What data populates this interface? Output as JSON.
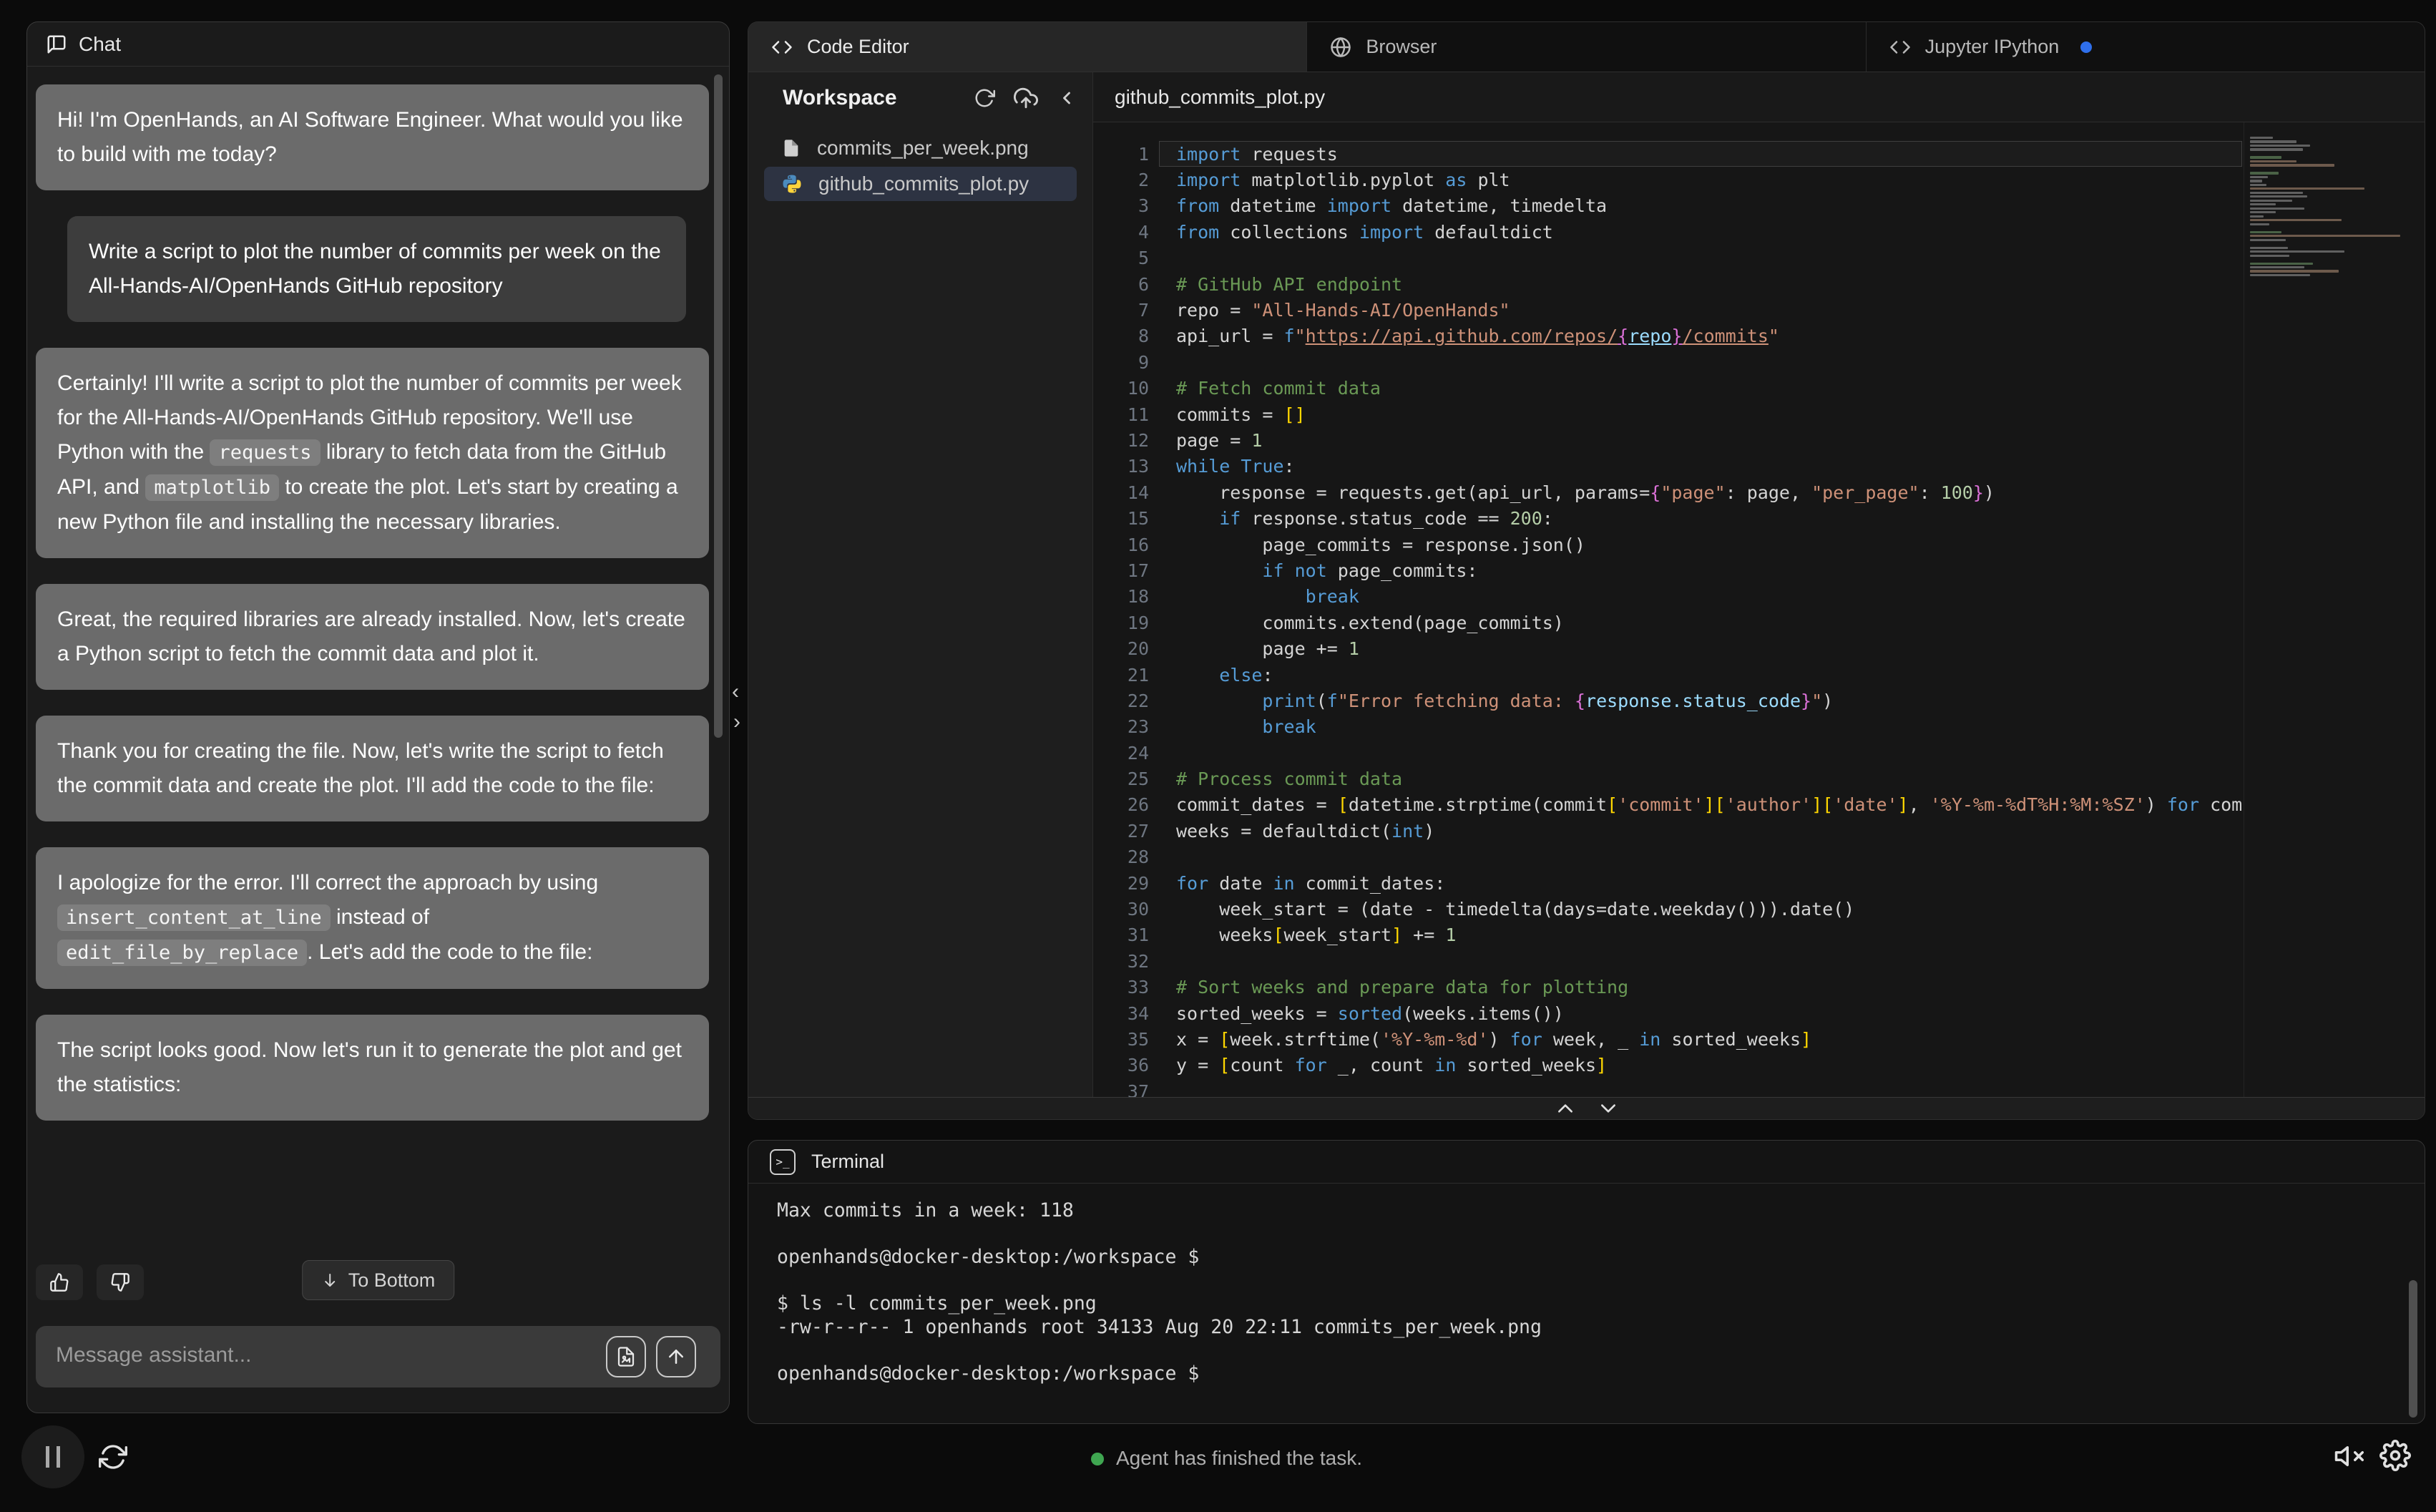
{
  "chat": {
    "title": "Chat",
    "messages": [
      {
        "role": "assistant",
        "parts": [
          {
            "t": "text",
            "v": "Hi! I'm OpenHands, an AI Software Engineer. What would you like to build with me today?"
          }
        ]
      },
      {
        "role": "user",
        "parts": [
          {
            "t": "text",
            "v": "Write a script to plot the number of commits per week on the All-Hands-AI/OpenHands GitHub repository"
          }
        ]
      },
      {
        "role": "assistant",
        "parts": [
          {
            "t": "text",
            "v": "Certainly! I'll write a script to plot the number of commits per week for the All-Hands-AI/OpenHands GitHub repository. We'll use Python with the "
          },
          {
            "t": "code",
            "v": "requests"
          },
          {
            "t": "text",
            "v": " library to fetch data from the GitHub API, and "
          },
          {
            "t": "code",
            "v": "matplotlib"
          },
          {
            "t": "text",
            "v": " to create the plot. Let's start by creating a new Python file and installing the necessary libraries."
          }
        ]
      },
      {
        "role": "assistant",
        "parts": [
          {
            "t": "text",
            "v": "Great, the required libraries are already installed. Now, let's create a Python script to fetch the commit data and plot it."
          }
        ]
      },
      {
        "role": "assistant",
        "parts": [
          {
            "t": "text",
            "v": "Thank you for creating the file. Now, let's write the script to fetch the commit data and create the plot. I'll add the code to the file:"
          }
        ]
      },
      {
        "role": "assistant",
        "parts": [
          {
            "t": "text",
            "v": "I apologize for the error. I'll correct the approach by using "
          },
          {
            "t": "code",
            "v": "insert_content_at_line"
          },
          {
            "t": "text",
            "v": " instead of "
          },
          {
            "t": "code",
            "v": "edit_file_by_replace"
          },
          {
            "t": "text",
            "v": ". Let's add the code to the file:"
          }
        ]
      },
      {
        "role": "assistant",
        "parts": [
          {
            "t": "text",
            "v": "The script looks good. Now let's run it to generate the plot and get the statistics:"
          }
        ]
      }
    ],
    "to_bottom_label": "To Bottom",
    "input_placeholder": "Message assistant..."
  },
  "tabs": [
    {
      "label": "Code Editor",
      "icon": "code",
      "active": true
    },
    {
      "label": "Browser",
      "icon": "globe",
      "active": false
    },
    {
      "label": "Jupyter IPython",
      "icon": "code",
      "active": false,
      "dot": true
    }
  ],
  "workspace": {
    "title": "Workspace",
    "files": [
      {
        "name": "commits_per_week.png",
        "icon": "file",
        "selected": false
      },
      {
        "name": "github_commits_plot.py",
        "icon": "python",
        "selected": true
      }
    ]
  },
  "editor": {
    "filename": "github_commits_plot.py",
    "lines": [
      [
        [
          "k",
          "import"
        ],
        [
          "d",
          " requests"
        ]
      ],
      [
        [
          "k",
          "import"
        ],
        [
          "d",
          " matplotlib.pyplot "
        ],
        [
          "k",
          "as"
        ],
        [
          "d",
          " plt"
        ]
      ],
      [
        [
          "k",
          "from"
        ],
        [
          "d",
          " datetime "
        ],
        [
          "k",
          "import"
        ],
        [
          "d",
          " datetime, timedelta"
        ]
      ],
      [
        [
          "k",
          "from"
        ],
        [
          "d",
          " collections "
        ],
        [
          "k",
          "import"
        ],
        [
          "d",
          " defaultdict"
        ]
      ],
      [],
      [
        [
          "c",
          "# GitHub API endpoint"
        ]
      ],
      [
        [
          "d",
          "repo = "
        ],
        [
          "s",
          "\"All-Hands-AI/OpenHands\""
        ]
      ],
      [
        [
          "d",
          "api_url = "
        ],
        [
          "k",
          "f"
        ],
        [
          "s",
          "\""
        ],
        [
          "s u",
          "https://api.github.com/repos/"
        ],
        [
          "m u",
          "{"
        ],
        [
          "v u",
          "repo"
        ],
        [
          "m u",
          "}"
        ],
        [
          "s u",
          "/commits"
        ],
        [
          "s",
          "\""
        ]
      ],
      [],
      [
        [
          "c",
          "# Fetch commit data"
        ]
      ],
      [
        [
          "d",
          "commits = "
        ],
        [
          "b",
          "[]"
        ]
      ],
      [
        [
          "d",
          "page = "
        ],
        [
          "n",
          "1"
        ]
      ],
      [
        [
          "k",
          "while"
        ],
        [
          "d",
          " "
        ],
        [
          "k",
          "True"
        ],
        [
          "d",
          ":"
        ]
      ],
      [
        [
          "d",
          "    response = requests.get(api_url, params="
        ],
        [
          "m",
          "{"
        ],
        [
          "s",
          "\"page\""
        ],
        [
          "d",
          ": page, "
        ],
        [
          "s",
          "\"per_page\""
        ],
        [
          "d",
          ": "
        ],
        [
          "n",
          "100"
        ],
        [
          "m",
          "}"
        ],
        [
          "d",
          ")"
        ]
      ],
      [
        [
          "d",
          "    "
        ],
        [
          "k",
          "if"
        ],
        [
          "d",
          " response.status_code == "
        ],
        [
          "n",
          "200"
        ],
        [
          "d",
          ":"
        ]
      ],
      [
        [
          "d",
          "        page_commits = response.json()"
        ]
      ],
      [
        [
          "d",
          "        "
        ],
        [
          "k",
          "if"
        ],
        [
          "d",
          " "
        ],
        [
          "k",
          "not"
        ],
        [
          "d",
          " page_commits:"
        ]
      ],
      [
        [
          "d",
          "            "
        ],
        [
          "k",
          "break"
        ]
      ],
      [
        [
          "d",
          "        commits.extend(page_commits)"
        ]
      ],
      [
        [
          "d",
          "        page += "
        ],
        [
          "n",
          "1"
        ]
      ],
      [
        [
          "d",
          "    "
        ],
        [
          "k",
          "else"
        ],
        [
          "d",
          ":"
        ]
      ],
      [
        [
          "d",
          "        "
        ],
        [
          "k",
          "print"
        ],
        [
          "d",
          "("
        ],
        [
          "k",
          "f"
        ],
        [
          "s",
          "\"Error fetching data: "
        ],
        [
          "m",
          "{"
        ],
        [
          "v",
          "response.status_code"
        ],
        [
          "m",
          "}"
        ],
        [
          "s",
          "\""
        ],
        [
          "d",
          ")"
        ]
      ],
      [
        [
          "d",
          "        "
        ],
        [
          "k",
          "break"
        ]
      ],
      [],
      [
        [
          "c",
          "# Process commit data"
        ]
      ],
      [
        [
          "d",
          "commit_dates = "
        ],
        [
          "b",
          "["
        ],
        [
          "d",
          "datetime.strptime(commit"
        ],
        [
          "b",
          "["
        ],
        [
          "s",
          "'commit'"
        ],
        [
          "b",
          "]"
        ],
        [
          "b",
          "["
        ],
        [
          "s",
          "'author'"
        ],
        [
          "b",
          "]"
        ],
        [
          "b",
          "["
        ],
        [
          "s",
          "'date'"
        ],
        [
          "b",
          "]"
        ],
        [
          "d",
          ", "
        ],
        [
          "s",
          "'%Y-%m-%dT%H:%M:%SZ'"
        ],
        [
          "d",
          ") "
        ],
        [
          "k",
          "for"
        ],
        [
          "d",
          " commit"
        ]
      ],
      [
        [
          "d",
          "weeks = defaultdict("
        ],
        [
          "k",
          "int"
        ],
        [
          "d",
          ")"
        ]
      ],
      [],
      [
        [
          "k",
          "for"
        ],
        [
          "d",
          " date "
        ],
        [
          "k",
          "in"
        ],
        [
          "d",
          " commit_dates:"
        ]
      ],
      [
        [
          "d",
          "    week_start = (date - timedelta(days=date.weekday())).date()"
        ]
      ],
      [
        [
          "d",
          "    weeks"
        ],
        [
          "b",
          "["
        ],
        [
          "d",
          "week_start"
        ],
        [
          "b",
          "]"
        ],
        [
          "d",
          " += "
        ],
        [
          "n",
          "1"
        ]
      ],
      [],
      [
        [
          "c",
          "# Sort weeks and prepare data for plotting"
        ]
      ],
      [
        [
          "d",
          "sorted_weeks = "
        ],
        [
          "k",
          "sorted"
        ],
        [
          "d",
          "(weeks.items())"
        ]
      ],
      [
        [
          "d",
          "x = "
        ],
        [
          "b",
          "["
        ],
        [
          "d",
          "week.strftime("
        ],
        [
          "s",
          "'%Y-%m-%d'"
        ],
        [
          "d",
          ") "
        ],
        [
          "k",
          "for"
        ],
        [
          "d",
          " week, _ "
        ],
        [
          "k",
          "in"
        ],
        [
          "d",
          " sorted_weeks"
        ],
        [
          "b",
          "]"
        ]
      ],
      [
        [
          "d",
          "y = "
        ],
        [
          "b",
          "["
        ],
        [
          "d",
          "count "
        ],
        [
          "k",
          "for"
        ],
        [
          "d",
          " _, count "
        ],
        [
          "k",
          "in"
        ],
        [
          "d",
          " sorted_weeks"
        ],
        [
          "b",
          "]"
        ]
      ],
      []
    ]
  },
  "terminal": {
    "title": "Terminal",
    "lines": [
      "Max commits in a week: 118",
      "",
      "openhands@docker-desktop:/workspace $",
      "",
      "$ ls -l commits_per_week.png",
      "-rw-r--r-- 1 openhands root 34133 Aug 20 22:11 commits_per_week.png",
      "",
      "openhands@docker-desktop:/workspace $"
    ]
  },
  "statusbar": {
    "status": "Agent has finished the task.",
    "dot_color": "#3fa651"
  },
  "colors": {
    "accent_blue_dot": "#2f6feb",
    "keyword": "#569cd6",
    "string": "#ce9178",
    "comment": "#6a9955",
    "number": "#b5cea8",
    "selected_file_bg": "#2d3342"
  }
}
